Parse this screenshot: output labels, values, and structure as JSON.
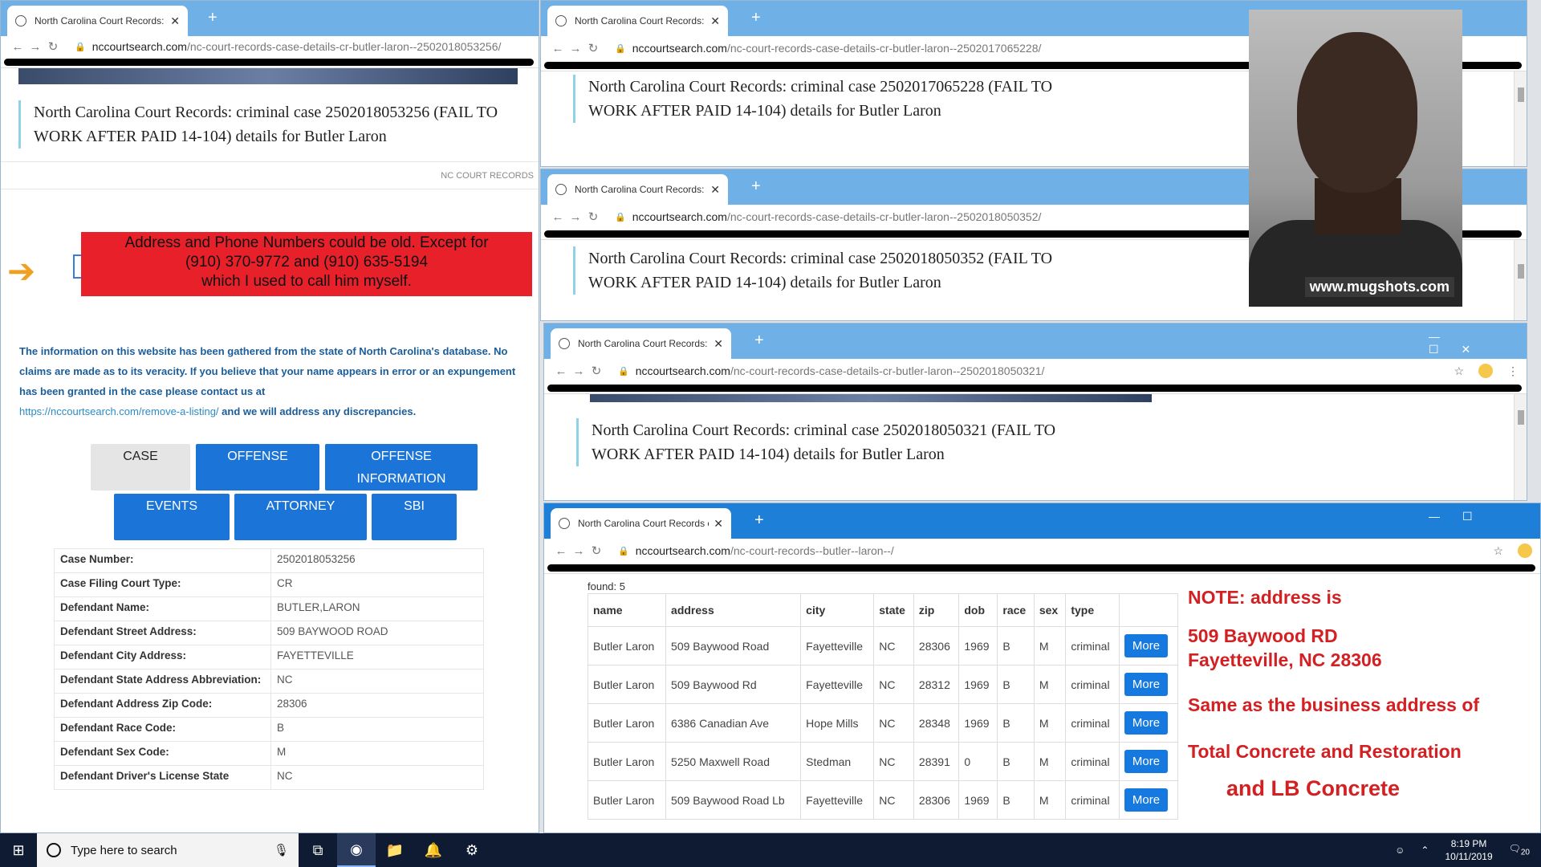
{
  "windows": {
    "left": {
      "tab_title": "North Carolina Court Records: cr",
      "url_domain": "nccourtsearch.com",
      "url_path": "/nc-court-records-case-details-cr-butler-laron--2502018053256/",
      "heading": "North Carolina Court Records: criminal case 2502018053256 (FAIL TO WORK AFTER PAID 14-104) details for Butler Laron",
      "small_label": "NC COURT RECORDS",
      "alert_lines": [
        "Address and Phone Numbers could be old. Except for",
        "(910) 370-9772 and (910) 635-5194",
        "which I used to call him myself."
      ],
      "info_text": "The information on this website has been gathered from the state of North Carolina's database. No claims are made as to its veracity. If you believe that your name appears in error or an expungement has been granted in the case please contact us at",
      "info_link": "https://nccourtsearch.com/remove-a-listing/",
      "info_tail": "and we will address any discrepancies.",
      "tabs": [
        "CASE",
        "OFFENSE",
        "OFFENSE INFORMATION",
        "EVENTS",
        "ATTORNEY",
        "SBI"
      ],
      "case_rows": [
        {
          "label": "Case Number:",
          "value": "2502018053256"
        },
        {
          "label": "Case Filing Court Type:",
          "value": "CR"
        },
        {
          "label": "Defendant Name:",
          "value": "BUTLER,LARON"
        },
        {
          "label": "Defendant Street Address:",
          "value": "509 BAYWOOD ROAD"
        },
        {
          "label": "Defendant City Address:",
          "value": "FAYETTEVILLE"
        },
        {
          "label": "Defendant State Address Abbreviation:",
          "value": "NC"
        },
        {
          "label": "Defendant Address Zip Code:",
          "value": "28306"
        },
        {
          "label": "Defendant Race Code:",
          "value": "B"
        },
        {
          "label": "Defendant Sex Code:",
          "value": "M"
        },
        {
          "label": "Defendant Driver's License State",
          "value": "NC"
        }
      ]
    },
    "w2": {
      "tab_title": "North Carolina Court Records: cr",
      "url_domain": "nccourtsearch.com",
      "url_path": "/nc-court-records-case-details-cr-butler-laron--2502017065228/",
      "heading": "North Carolina Court Records: criminal case 2502017065228 (FAIL TO WORK AFTER PAID 14-104) details for Butler Laron"
    },
    "w3": {
      "tab_title": "North Carolina Court Records: cr",
      "url_domain": "nccourtsearch.com",
      "url_path": "/nc-court-records-case-details-cr-butler-laron--2502018050352/",
      "heading": "North Carolina Court Records: criminal case 2502018050352 (FAIL TO WORK AFTER PAID 14-104) details for Butler Laron"
    },
    "w4": {
      "tab_title": "North Carolina Court Records: cr",
      "url_domain": "nccourtsearch.com",
      "url_path": "/nc-court-records-case-details-cr-butler-laron--2502018050321/",
      "heading": "North Carolina Court Records: criminal case 2502018050321 (FAIL TO WORK AFTER PAID 14-104) details for Butler Laron"
    },
    "w5": {
      "tab_title": "North Carolina Court Records ex",
      "url_domain": "nccourtsearch.com",
      "url_path": "/nc-court-records--butler--laron--/",
      "found": "found: 5",
      "columns": [
        "name",
        "address",
        "city",
        "state",
        "zip",
        "dob",
        "race",
        "sex",
        "type",
        ""
      ],
      "rows": [
        [
          "Butler Laron",
          "509 Baywood Road",
          "Fayetteville",
          "NC",
          "28306",
          "1969",
          "B",
          "M",
          "criminal"
        ],
        [
          "Butler Laron",
          "509 Baywood Rd",
          "Fayetteville",
          "NC",
          "28312",
          "1969",
          "B",
          "M",
          "criminal"
        ],
        [
          "Butler Laron",
          "6386 Canadian Ave",
          "Hope Mills",
          "NC",
          "28348",
          "1969",
          "B",
          "M",
          "criminal"
        ],
        [
          "Butler Laron",
          "5250 Maxwell Road",
          "Stedman",
          "NC",
          "28391",
          "0",
          "B",
          "M",
          "criminal"
        ],
        [
          "Butler Laron",
          "509 Baywood Road Lb",
          "Fayetteville",
          "NC",
          "28306",
          "1969",
          "B",
          "M",
          "criminal"
        ]
      ],
      "more_label": "More",
      "note_lines": [
        "NOTE: address is",
        "509 Baywood RD",
        "Fayetteville, NC 28306",
        "Same as the business address of",
        "Total Concrete and Restoration",
        "and LB Concrete"
      ]
    }
  },
  "mugshot_watermark": "www.mugshots.com",
  "taskbar": {
    "search_placeholder": "Type here to search",
    "time": "8:19 PM",
    "date": "10/11/2019",
    "notif_count": "20"
  },
  "colors": {
    "tabbar": "#6fb0e7",
    "button": "#1b74d8",
    "alert": "#e8202a",
    "note": "#d32023"
  }
}
